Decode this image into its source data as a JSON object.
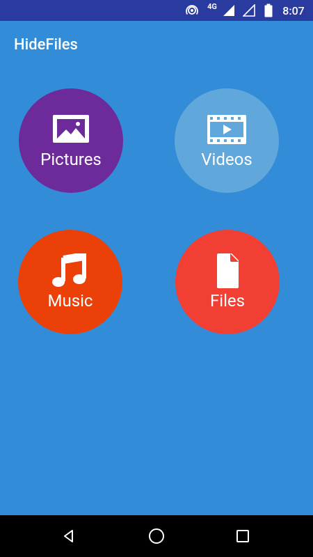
{
  "status_bar": {
    "network_type": "4G",
    "time": "8:07",
    "icons": [
      "hotspot-icon",
      "cell-signal-icon",
      "cell-signal-empty-icon",
      "battery-icon"
    ]
  },
  "app": {
    "title": "HideFiles"
  },
  "tiles": [
    {
      "label": "Pictures",
      "icon": "image-icon",
      "color": "#6D2A9A"
    },
    {
      "label": "Videos",
      "icon": "film-icon",
      "color": "#60A7DC"
    },
    {
      "label": "Music",
      "icon": "music-note-icon",
      "color": "#EB4007"
    },
    {
      "label": "Files",
      "icon": "file-icon",
      "color": "#F23F34"
    }
  ],
  "nav_bar": {
    "buttons": [
      "back-icon",
      "home-icon",
      "recents-icon"
    ]
  },
  "colors": {
    "status_bar": "#293B9F",
    "background": "#338CD8",
    "nav_bar": "#000000"
  }
}
